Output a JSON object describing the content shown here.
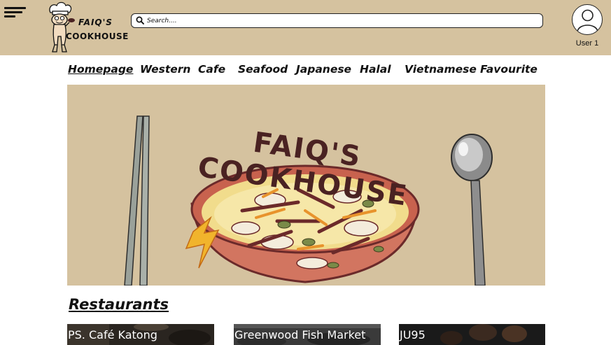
{
  "header": {
    "brand_line1": "FAIQ'S",
    "brand_line2": "COOKHOUSE",
    "search_placeholder": "Search....",
    "user_label": "User 1"
  },
  "nav": {
    "items": [
      {
        "label": "Homepage",
        "active": true
      },
      {
        "label": "Western",
        "active": false
      },
      {
        "label": "Cafe",
        "active": false
      },
      {
        "label": "Seafood",
        "active": false
      },
      {
        "label": "Japanese",
        "active": false
      },
      {
        "label": "Halal",
        "active": false
      },
      {
        "label": "Vietnamese",
        "active": false
      },
      {
        "label": "Favourite",
        "active": false
      }
    ]
  },
  "banner": {
    "title": "FAIQ'S COOKHOUSE"
  },
  "restaurants": {
    "title": "Restaurants",
    "cards": [
      {
        "name": "PS. Café Katong"
      },
      {
        "name": "Greenwood Fish Market"
      },
      {
        "name": "JU95"
      }
    ]
  },
  "colors": {
    "header_bg": "#d5c29f",
    "banner_bg": "#d5c29f",
    "brand_text": "#4a2222"
  }
}
